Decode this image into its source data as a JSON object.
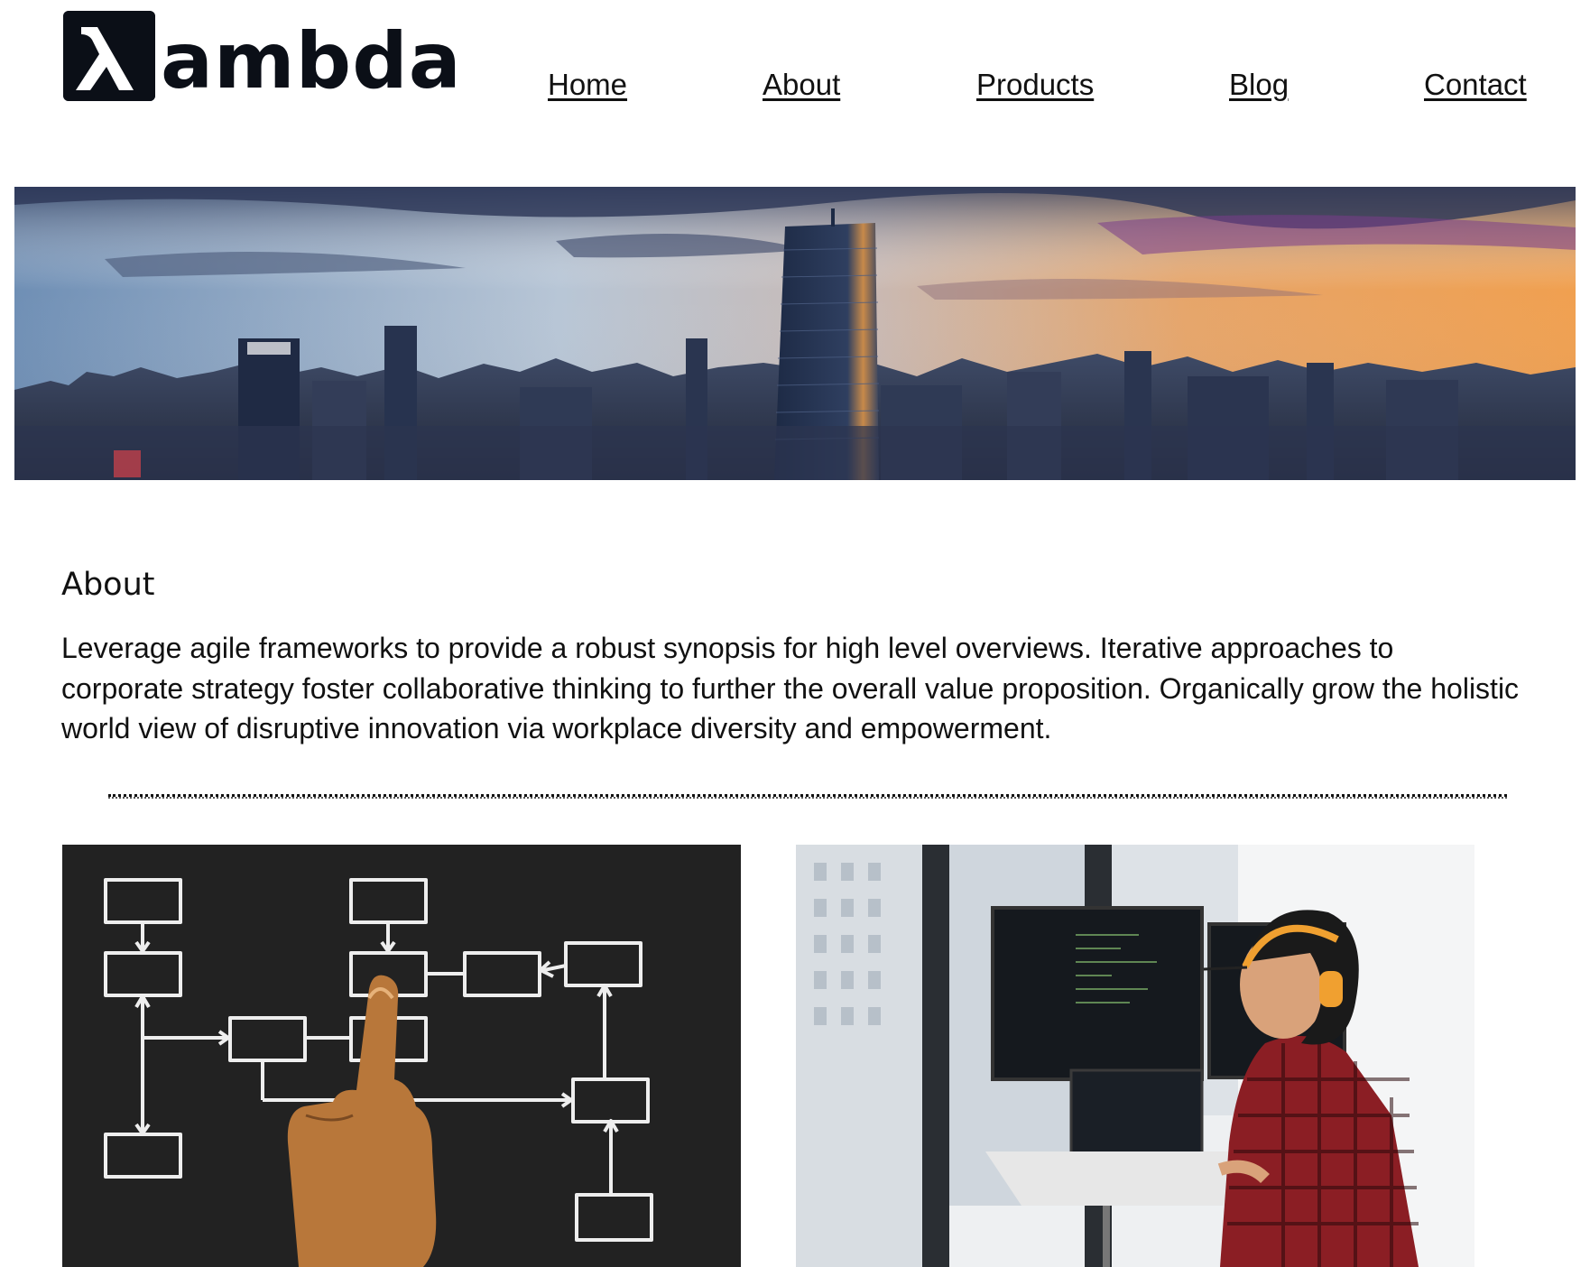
{
  "brand": {
    "logo_glyph": "λ",
    "logo_text": "ambda",
    "logo_color": "#0b0f17"
  },
  "nav": {
    "items": [
      {
        "label": "Home"
      },
      {
        "label": "About"
      },
      {
        "label": "Products"
      },
      {
        "label": "Blog"
      },
      {
        "label": "Contact"
      }
    ]
  },
  "hero": {
    "image": "city-skyline-at-sunset"
  },
  "about": {
    "title": "About",
    "body": "Leverage agile frameworks to provide a robust synopsis for high level overviews. Iterative approaches to corporate strategy foster collaborative thinking to further the overall value proposition. Organically grow the holistic world view of disruptive innovation via workplace diversity and empowerment."
  },
  "gallery": {
    "left_image": "flowchart-on-chalkboard-with-hand",
    "right_image": "developer-at-desk-with-monitors"
  }
}
